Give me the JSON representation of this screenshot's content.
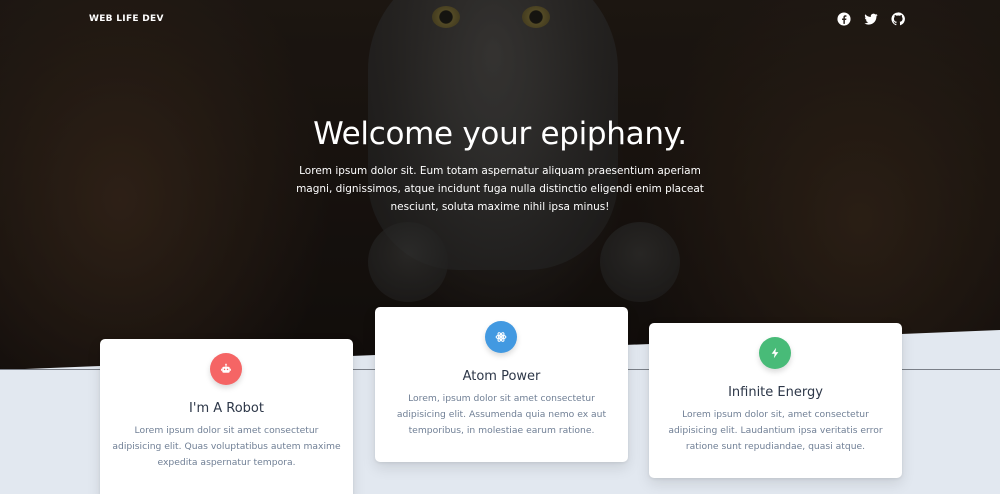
{
  "brand": "WEB LIFE DEV",
  "social": [
    {
      "icon": "facebook-icon"
    },
    {
      "icon": "twitter-icon"
    },
    {
      "icon": "github-icon"
    }
  ],
  "hero": {
    "title": "Welcome your epiphany.",
    "subtitle": "Lorem ipsum dolor sit. Eum totam aspernatur aliquam praesentium aperiam magni, dignissimos, atque incidunt fuga nulla distinctio eligendi enim placeat nesciunt, soluta maxime nihil ipsa minus!"
  },
  "cards": [
    {
      "title": "I'm A Robot",
      "text": "Lorem ipsum dolor sit amet consectetur adipisicing elit. Quas voluptatibus autem maxime expedita aspernatur tempora.",
      "icon": "robot-icon",
      "color": "#f56565"
    },
    {
      "title": "Atom Power",
      "text": "Lorem, ipsum dolor sit amet consectetur adipisicing elit. Assumenda quia nemo ex aut temporibus, in molestiae earum ratione.",
      "icon": "atom-icon",
      "color": "#4299e1"
    },
    {
      "title": "Infinite Energy",
      "text": "Lorem ipsum dolor sit, amet consectetur adipisicing elit. Laudantium ipsa veritatis error ratione sunt repudiandae, quasi atque.",
      "icon": "lightning-icon",
      "color": "#48bb78"
    }
  ]
}
